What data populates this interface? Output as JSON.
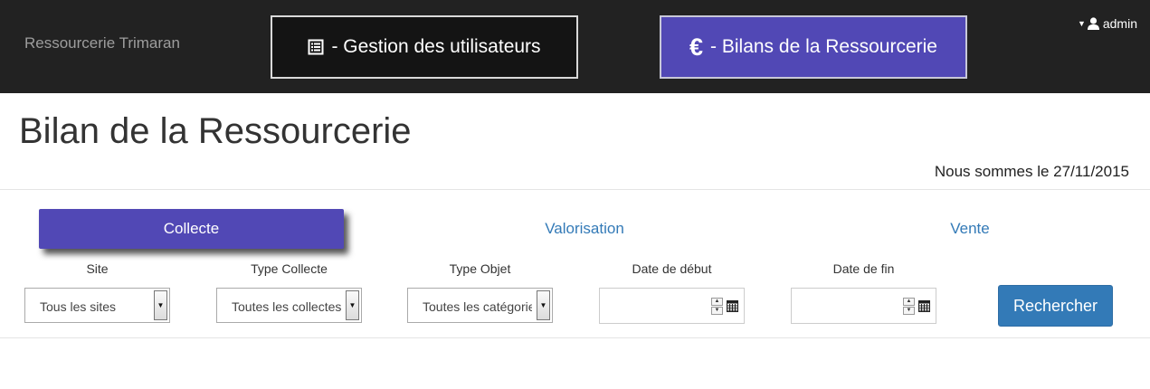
{
  "navbar": {
    "brand": "Ressourcerie Trimaran",
    "users_button": "- Gestion des utilisateurs",
    "bilans_button": "- Bilans de la Ressourcerie",
    "euro_symbol": "€",
    "user_name": "admin",
    "icons": {
      "users": "list-icon",
      "user": "user-icon"
    },
    "colors": {
      "background": "#222222",
      "active_button": "#5148b5"
    }
  },
  "header": {
    "title": "Bilan de la Ressourcerie",
    "date_line": "Nous sommes le 27/11/2015"
  },
  "tabs": [
    {
      "label": "Collecte",
      "active": true
    },
    {
      "label": "Valorisation",
      "active": false
    },
    {
      "label": "Vente",
      "active": false
    }
  ],
  "filters": {
    "site_label": "Site",
    "site_value": "Tous les sites",
    "type_collecte_label": "Type Collecte",
    "type_collecte_value": "Toutes les collectes",
    "type_objet_label": "Type Objet",
    "type_objet_value": "Toutes les catégories",
    "date_debut_label": "Date de début",
    "date_debut_value": "",
    "date_fin_label": "Date de fin",
    "date_fin_value": "",
    "search_button": "Rechercher"
  },
  "colors": {
    "accent": "#5148b5",
    "link": "#337ab7",
    "primary_button": "#337ab7"
  }
}
